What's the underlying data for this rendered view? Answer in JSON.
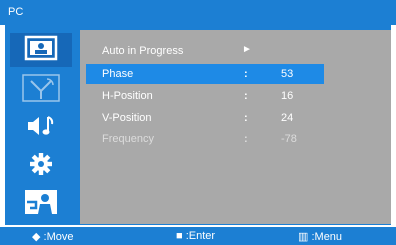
{
  "menu": {
    "title": "PC"
  },
  "sidebar": {
    "items": [
      {
        "icon": "picture-icon",
        "selected": true
      },
      {
        "icon": "antenna-icon",
        "selected": false
      },
      {
        "icon": "sound-icon",
        "selected": false
      },
      {
        "icon": "gear-icon",
        "selected": false
      },
      {
        "icon": "person-icon",
        "selected": false
      }
    ]
  },
  "settings": {
    "auto_label": "Auto in Progress",
    "auto_arrow": "►",
    "rows": [
      {
        "label": "Phase",
        "colon": ":",
        "value": "53"
      },
      {
        "label": "H-Position",
        "colon": ":",
        "value": "16"
      },
      {
        "label": "V-Position",
        "colon": ":",
        "value": "24"
      },
      {
        "label": "Frequency",
        "colon": ":",
        "value": "-78"
      }
    ]
  },
  "footer": {
    "move_icon": "◆",
    "move": ":Move",
    "enter_icon": "■",
    "enter": ":Enter",
    "menu_icon": "▥",
    "menu": ":Menu"
  },
  "colors": {
    "accent": "#1c7fd3",
    "selection": "#1e8ae6",
    "panel": "#a9a9a9"
  }
}
